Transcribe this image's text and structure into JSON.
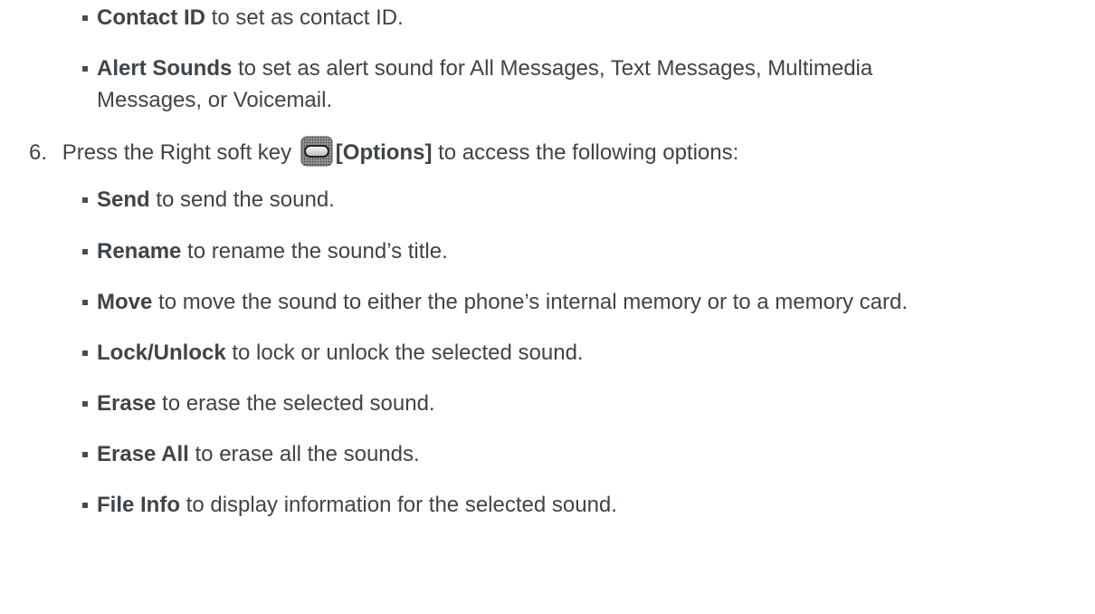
{
  "top_items": [
    {
      "term": "Contact ID",
      "rest": " to set as contact ID."
    },
    {
      "term": "Alert Sounds",
      "rest": " to set as alert sound for All Messages, Text Messages, Multimedia",
      "cont": "Messages, or Voicemail."
    }
  ],
  "step": {
    "number": "6.",
    "before": "Press the Right soft key ",
    "icon": "right-soft-key-icon",
    "term": "[Options]",
    "after": " to access the following options:"
  },
  "options": [
    {
      "term": "Send",
      "rest": " to send the sound."
    },
    {
      "term": "Rename",
      "rest": " to rename the sound’s title."
    },
    {
      "term": "Move",
      "rest": " to move the sound to either the phone’s internal memory or to a memory card."
    },
    {
      "term": "Lock/Unlock",
      "rest": " to lock or unlock the selected sound."
    },
    {
      "term": "Erase",
      "rest": " to erase the selected sound."
    },
    {
      "term": "Erase All",
      "rest": " to erase all the sounds."
    },
    {
      "term": "File Info",
      "rest": " to display information for the selected sound."
    }
  ]
}
